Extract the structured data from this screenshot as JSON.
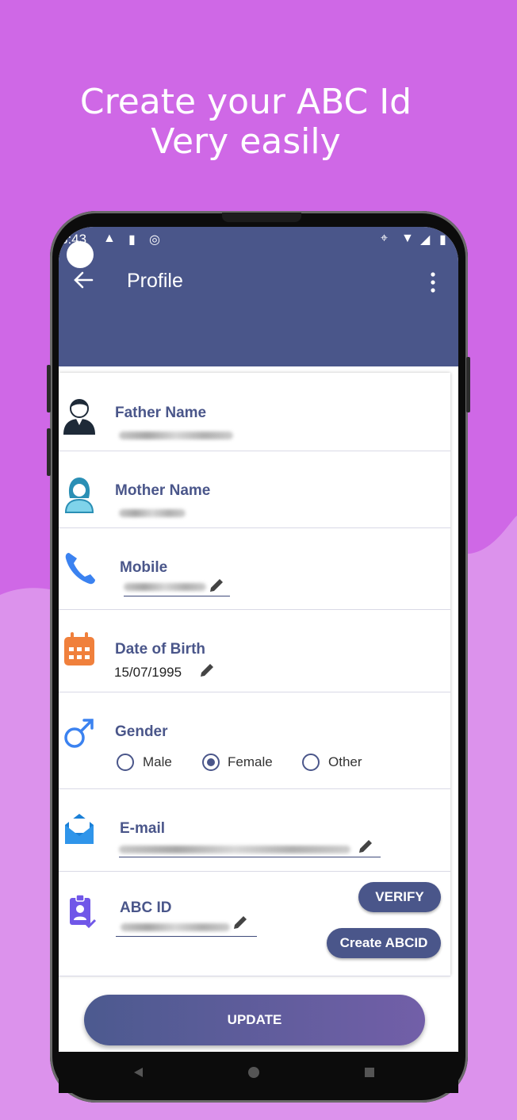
{
  "headline": {
    "line1": "Create your ABC Id",
    "line2": "Very easily"
  },
  "status_bar": {
    "time": "3:43"
  },
  "app_bar": {
    "title": "Profile"
  },
  "profile": {
    "father_name": {
      "label": "Father Name"
    },
    "mother_name": {
      "label": "Mother Name"
    },
    "mobile": {
      "label": "Mobile"
    },
    "dob": {
      "label": "Date of Birth",
      "value": "15/07/1995"
    },
    "gender": {
      "label": "Gender",
      "options": [
        "Male",
        "Female",
        "Other"
      ],
      "selected": "Female"
    },
    "email": {
      "label": "E-mail"
    },
    "abc_id": {
      "label": "ABC ID",
      "verify_label": "VERIFY",
      "create_label": "Create ABCID"
    }
  },
  "update_label": "UPDATE",
  "colors": {
    "background": "#cf68e6",
    "appbar": "#4a568a",
    "accent": "#4a568a"
  }
}
